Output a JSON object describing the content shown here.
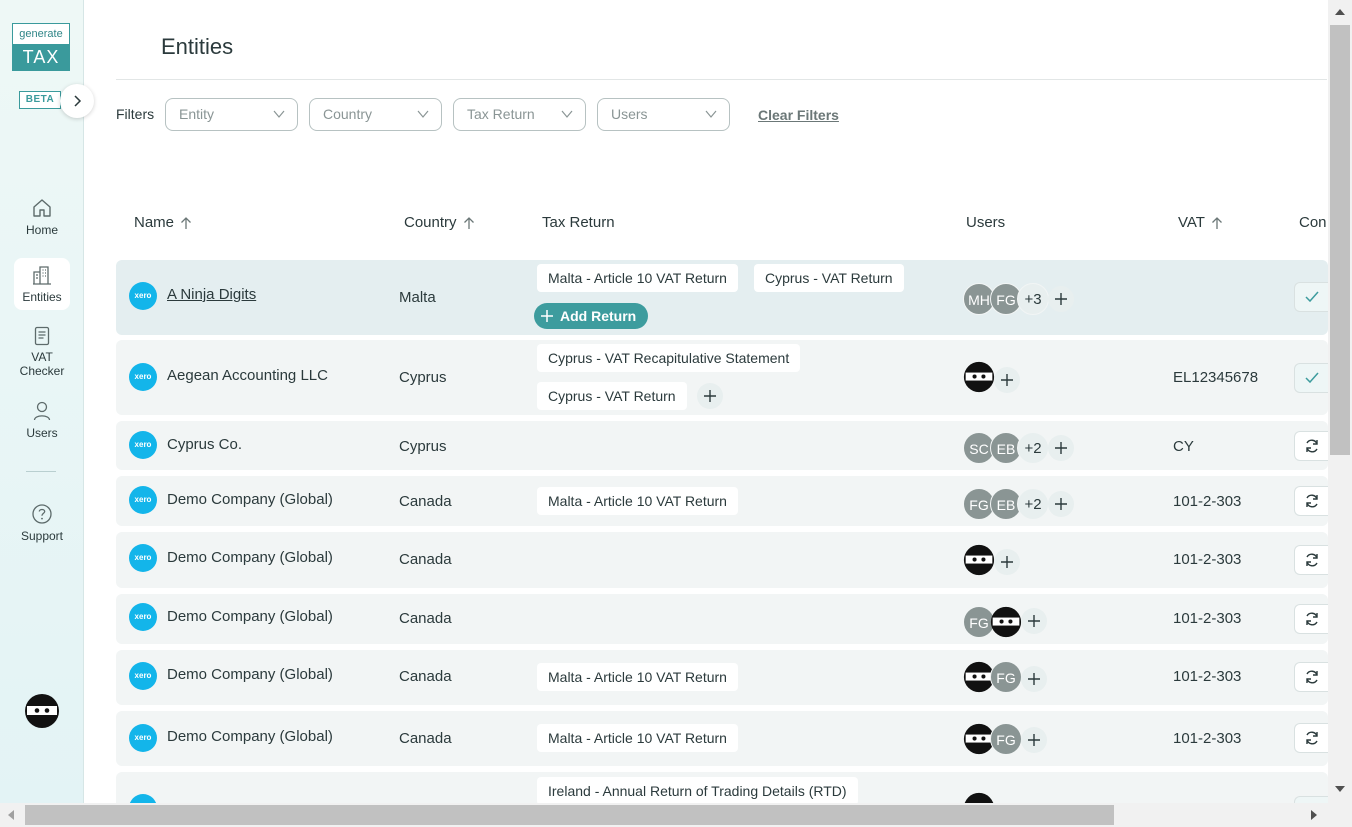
{
  "app": {
    "logo_top": "generate",
    "logo_bottom": "TAX",
    "beta": "BETA"
  },
  "sidebar": {
    "items": [
      {
        "label": "Home",
        "icon": "home-icon"
      },
      {
        "label": "Entities",
        "icon": "buildings-icon"
      },
      {
        "label": "VAT Checker",
        "icon": "document-icon"
      },
      {
        "label": "Users",
        "icon": "user-icon"
      },
      {
        "label": "Support",
        "icon": "help-icon"
      }
    ]
  },
  "page": {
    "title": "Entities"
  },
  "filters": {
    "label": "Filters",
    "entity_placeholder": "Entity",
    "country_placeholder": "Country",
    "tax_return_placeholder": "Tax Return",
    "users_placeholder": "Users",
    "clear": "Clear Filters"
  },
  "table": {
    "headers": {
      "name": "Name",
      "country": "Country",
      "tax_return": "Tax Return",
      "users": "Users",
      "vat": "VAT",
      "connection": "Con"
    },
    "add_return_label": "Add Return",
    "xero_label": "xero",
    "rows": [
      {
        "name": "A Ninja Digits",
        "country": "Malta",
        "vat": "",
        "returns": [
          "Malta - Article 10 VAT Return",
          "Cyprus - VAT Return"
        ],
        "users": [
          "MH",
          "FG",
          "+3"
        ],
        "status": "check"
      },
      {
        "name": "Aegean Accounting LLC",
        "country": "Cyprus",
        "vat": "EL12345678",
        "returns": [
          "Cyprus - VAT Recapitulative Statement",
          "Cyprus - VAT Return"
        ],
        "users": [
          "ninja"
        ],
        "status": "check"
      },
      {
        "name": "Cyprus Co.",
        "country": "Cyprus",
        "vat": "CY",
        "returns": [],
        "users": [
          "SC",
          "EB",
          "+2"
        ],
        "status": "sync"
      },
      {
        "name": "Demo Company (Global)",
        "country": "Canada",
        "vat": "101-2-303",
        "returns": [
          "Malta - Article 10 VAT Return"
        ],
        "users": [
          "FG",
          "EB",
          "+2"
        ],
        "status": "sync"
      },
      {
        "name": "Demo Company (Global)",
        "country": "Canada",
        "vat": "101-2-303",
        "returns": [],
        "users": [
          "ninja"
        ],
        "status": "sync"
      },
      {
        "name": "Demo Company (Global)",
        "country": "Canada",
        "vat": "101-2-303",
        "returns": [],
        "users": [
          "FG",
          "ninja"
        ],
        "status": "sync"
      },
      {
        "name": "Demo Company (Global)",
        "country": "Canada",
        "vat": "101-2-303",
        "returns": [
          "Malta - Article 10 VAT Return"
        ],
        "users": [
          "ninja",
          "FG"
        ],
        "status": "sync"
      },
      {
        "name": "Demo Company (Global)",
        "country": "Canada",
        "vat": "101-2-303",
        "returns": [
          "Malta - Article 10 VAT Return"
        ],
        "users": [
          "ninja",
          "FG"
        ],
        "status": "sync"
      },
      {
        "name": "",
        "country": "",
        "vat": "",
        "returns": [
          "Ireland - Annual Return of Trading Details (RTD)"
        ],
        "users": [],
        "status": "check"
      }
    ]
  },
  "colors": {
    "accent": "#3d9c9e",
    "xero": "#13b5ea",
    "row_bg": "#f2f5f5",
    "row_selected_bg": "#e4eef0"
  }
}
